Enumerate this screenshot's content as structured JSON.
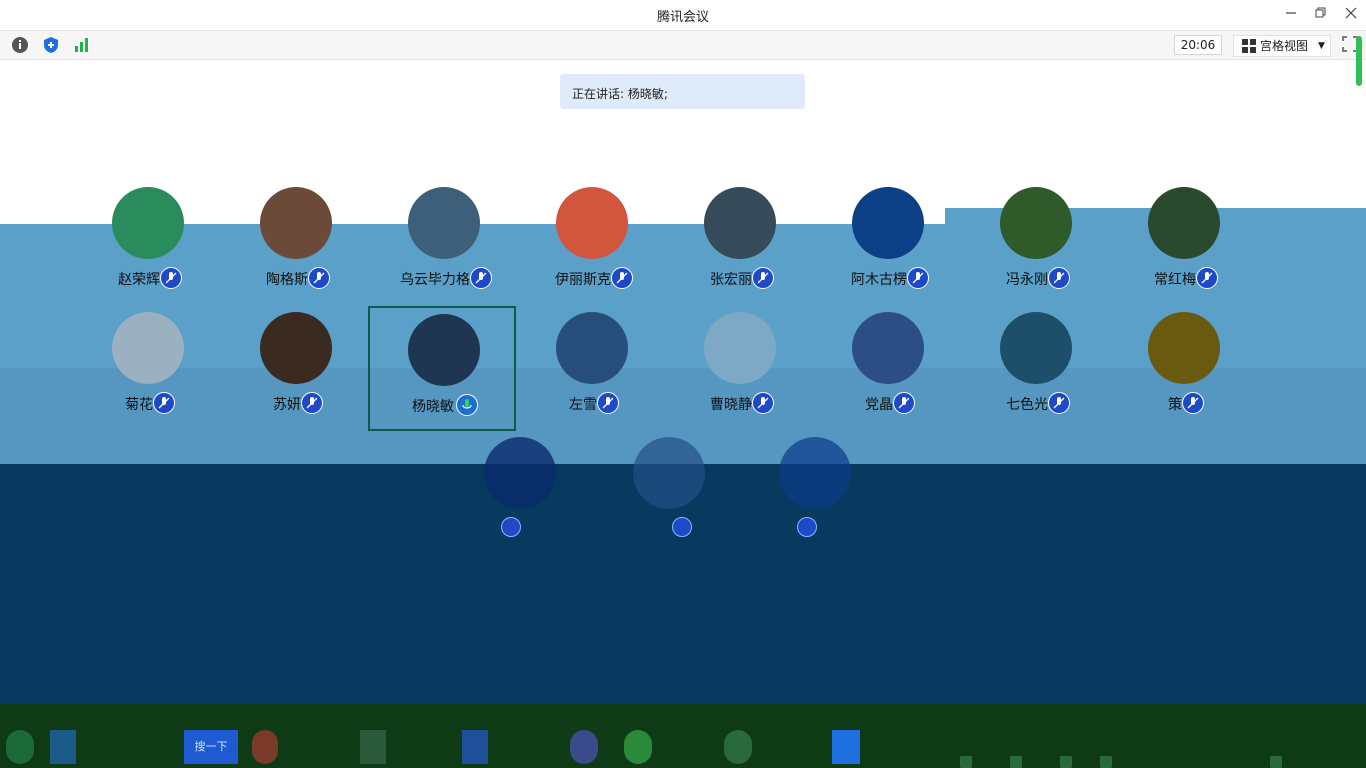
{
  "window": {
    "title": "腾讯会议"
  },
  "toolbar": {
    "time": "20:06",
    "view_label": "宫格视图",
    "info_icon": "info-icon",
    "shield_icon": "shield-icon",
    "signal_icon": "signal-icon"
  },
  "speaking": {
    "text": "正在讲话: 杨晓敏;"
  },
  "participants": [
    {
      "name": "赵荣辉",
      "avatar_color": "#2a8c5c"
    },
    {
      "name": "陶格斯",
      "avatar_color": "#6b4a3a"
    },
    {
      "name": "乌云毕力格",
      "avatar_color": "#3e5f7a"
    },
    {
      "name": "伊丽斯克",
      "avatar_color": "#d2553e"
    },
    {
      "name": "张宏丽",
      "avatar_color": "#354b5a"
    },
    {
      "name": "阿木古楞",
      "avatar_color": "#0b3f86"
    },
    {
      "name": "冯永刚",
      "avatar_color": "#2f5a2a"
    },
    {
      "name": "常红梅",
      "avatar_color": "#2a4a2f"
    },
    {
      "name": "菊花",
      "avatar_color": "#9bb0c0"
    },
    {
      "name": "苏妍",
      "avatar_color": "#3a2a20"
    },
    {
      "name": "杨晓敏",
      "avatar_color": "#1e3652"
    },
    {
      "name": "左雪",
      "avatar_color": "#274e7a"
    },
    {
      "name": "曹晓静",
      "avatar_color": "#7ea9c6"
    },
    {
      "name": "党晶",
      "avatar_color": "#2d4d86"
    },
    {
      "name": "七色光",
      "avatar_color": "#1d4e6a"
    },
    {
      "name": "策",
      "avatar_color": "#6a5a10"
    }
  ],
  "active_speaker": "杨晓敏",
  "taskbar": {
    "button_label": "搜一下"
  },
  "colors": {
    "accent_green": "#2fbf54",
    "mic_blue": "#1e49c8",
    "active_border": "#0d5a4a"
  }
}
